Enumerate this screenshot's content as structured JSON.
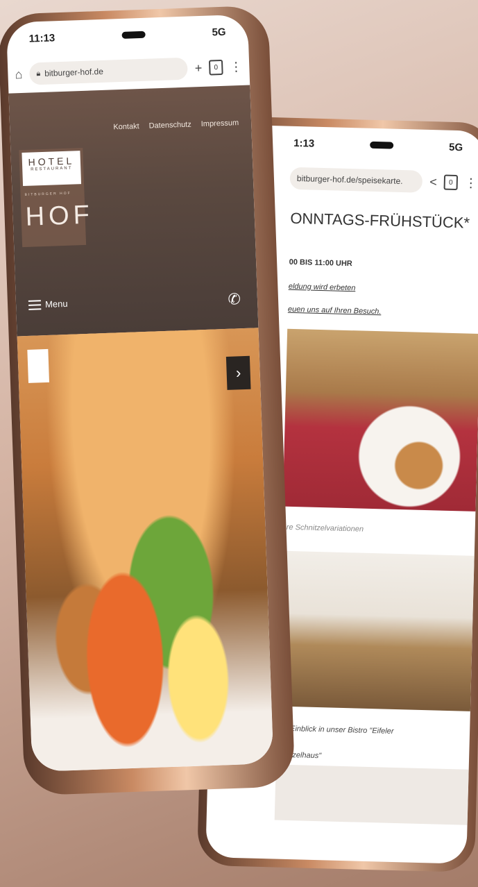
{
  "front": {
    "status": {
      "time": "11:13",
      "signal": "5G"
    },
    "browser": {
      "url": "bitburger-hof.de"
    },
    "site": {
      "top_links": [
        "Kontakt",
        "Datenschutz",
        "Impressum"
      ],
      "logo": {
        "hotel": "HOTEL",
        "restaurant": "RESTAURANT",
        "sub": "BITBURGER HOF",
        "hof": "HOF"
      },
      "menu_label": "Menu"
    }
  },
  "back": {
    "status": {
      "time": "1:13",
      "signal": "5G"
    },
    "browser": {
      "url": "bitburger-hof.de/speisekarte."
    },
    "content": {
      "title": "ONNTAGS-FRÜHSTÜCK*",
      "time": "00 BIS 11:00 UHR",
      "link1": "eldung wird erbeten",
      "link2": "euen uns auf Ihren Besuch.",
      "caption1": "ere Schnitzelvariationen",
      "caption2": "ner Einblick in unser Bistro \"Eifeler",
      "caption3": "chnitzelhaus\""
    }
  }
}
